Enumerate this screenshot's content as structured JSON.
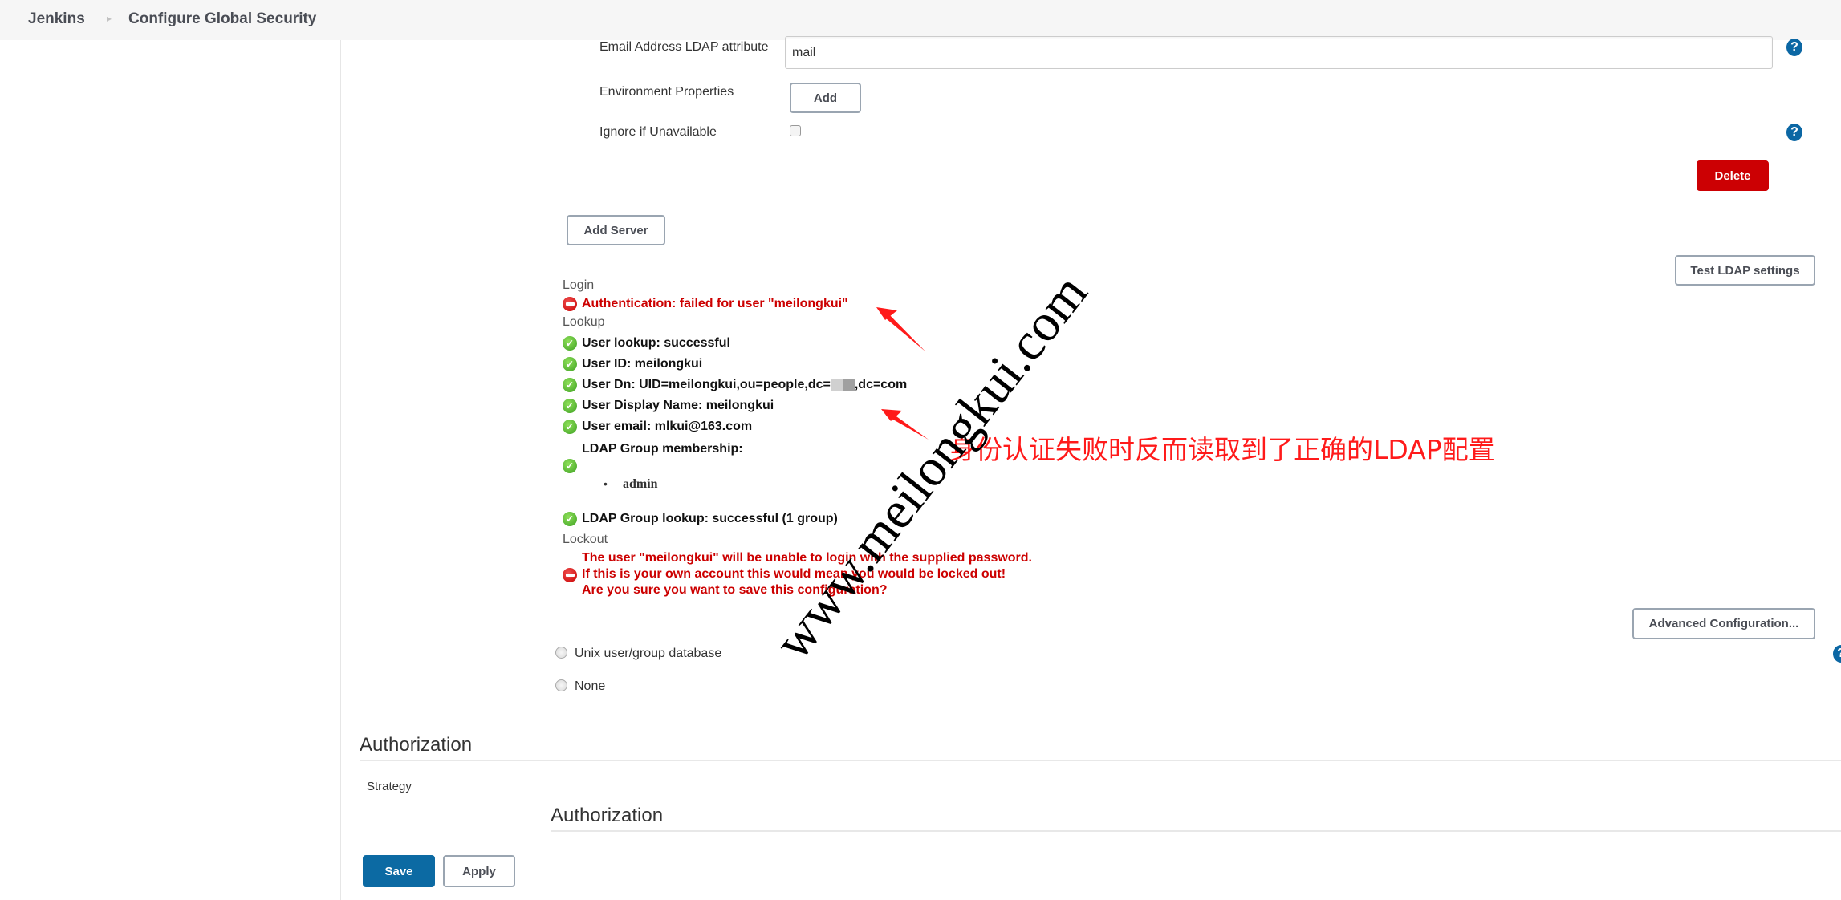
{
  "header": {
    "breadcrumb": [
      {
        "label": "Jenkins"
      },
      {
        "label": "Configure Global Security"
      }
    ],
    "separator_icon": "chevron-right-icon"
  },
  "ldap_server": {
    "email_attribute": {
      "label": "Email Address LDAP attribute",
      "value": "mail",
      "help_icon": "help-icon"
    },
    "environment_properties": {
      "label": "Environment Properties",
      "add_button": "Add"
    },
    "ignore_if_unavailable": {
      "label": "Ignore if Unavailable",
      "checked": false,
      "help_icon": "help-icon"
    },
    "delete_button": "Delete"
  },
  "add_server_button": "Add Server",
  "test_ldap_button": "Test LDAP settings",
  "test_results": {
    "login": {
      "title": "Login",
      "items": [
        {
          "status": "error",
          "icon": "error-icon",
          "text": "Authentication: failed for user \"meilongkui\""
        }
      ]
    },
    "lookup": {
      "title": "Lookup",
      "items": [
        {
          "status": "ok",
          "icon": "check-icon",
          "text": "User lookup: successful"
        },
        {
          "status": "ok",
          "icon": "check-icon",
          "text": "User ID: meilongkui"
        },
        {
          "status": "ok",
          "icon": "check-icon",
          "text_before": "User Dn: UID=meilongkui,ou=people,dc=",
          "redacted": true,
          "text_after": ",dc=com"
        },
        {
          "status": "ok",
          "icon": "check-icon",
          "text": "User Display Name: meilongkui"
        },
        {
          "status": "ok",
          "icon": "check-icon",
          "text": "User email: mlkui@163.com"
        },
        {
          "status": "ok",
          "icon": "check-icon",
          "text": "LDAP Group membership:",
          "groups": [
            "admin"
          ]
        },
        {
          "status": "ok",
          "icon": "check-icon",
          "text": "LDAP Group lookup: successful (1 group)"
        }
      ]
    },
    "lockout": {
      "title": "Lockout",
      "status": "error",
      "icon": "error-icon",
      "lines": [
        "The user \"meilongkui\" will be unable to login with the supplied password.",
        "If this is your own account this would mean you would be locked out!",
        "Are you sure you want to save this configuration?"
      ]
    }
  },
  "advanced_config_button": "Advanced Configuration...",
  "security_realm_options": [
    {
      "label": "Unix user/group database",
      "selected": false
    },
    {
      "label": "None",
      "selected": false
    }
  ],
  "authorization": {
    "section_title": "Authorization",
    "strategy_label": "Strategy",
    "strategy_value": "Authorization"
  },
  "footer": {
    "save_button": "Save",
    "apply_button": "Apply"
  },
  "overlay": {
    "annotation": "身份认证失败时反而读取到了正确的LDAP配置",
    "watermark": "www.meilongkui.com",
    "annotation_color": "#ff1a1a"
  },
  "colors": {
    "error": "#cc0000",
    "success": "#3da022",
    "primary": "#0c6aa3",
    "danger": "#cc0003"
  }
}
